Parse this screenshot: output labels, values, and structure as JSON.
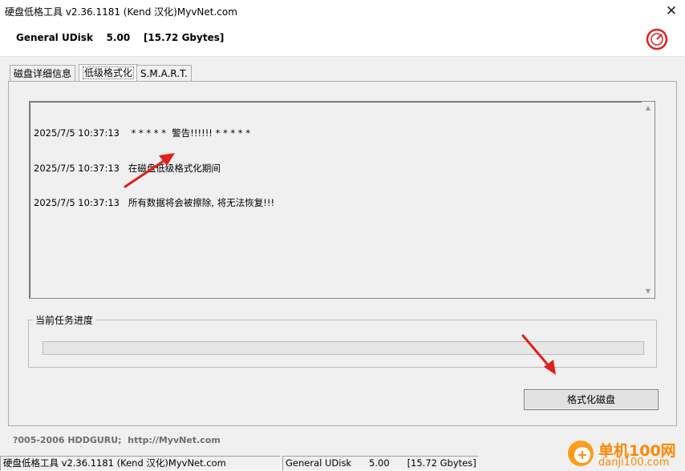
{
  "window": {
    "title": "硬盘低格工具 v2.36.1181 (Kend 汉化)MyvNet.com",
    "close_icon": "close-icon"
  },
  "header": {
    "device": "General UDisk    5.00    [15.72 Gbytes]",
    "logo_icon": "gauge-logo-icon"
  },
  "tabs": [
    {
      "label": "磁盘详细信息"
    },
    {
      "label": "低级格式化"
    },
    {
      "label": "S.M.A.R.T."
    }
  ],
  "log": {
    "lines": [
      "2025/7/5 10:37:13    * * * * *  警告!!!!!! * * * * *",
      "2025/7/5 10:37:13   在磁盘低级格式化期间",
      "2025/7/5 10:37:13   所有数据将会被擦除, 将无法恢复!!!"
    ]
  },
  "progress": {
    "label": "当前任务进度",
    "percent": 0
  },
  "format_button": "格式化磁盘",
  "copyright": "?005-2006 HDDGURU;  http://MyvNet.com",
  "statusbar": {
    "app": "硬盘低格工具 v2.36.1181 (Kend 汉化)MyvNet.com",
    "device": "General UDisk      5.00      [15.72 Gbytes]"
  },
  "watermark": {
    "name": "单机100网",
    "url": "danji100.com"
  },
  "colors": {
    "arrow": "#e0201b",
    "progress_fill": "#06b025",
    "watermark": "#ff8800"
  }
}
